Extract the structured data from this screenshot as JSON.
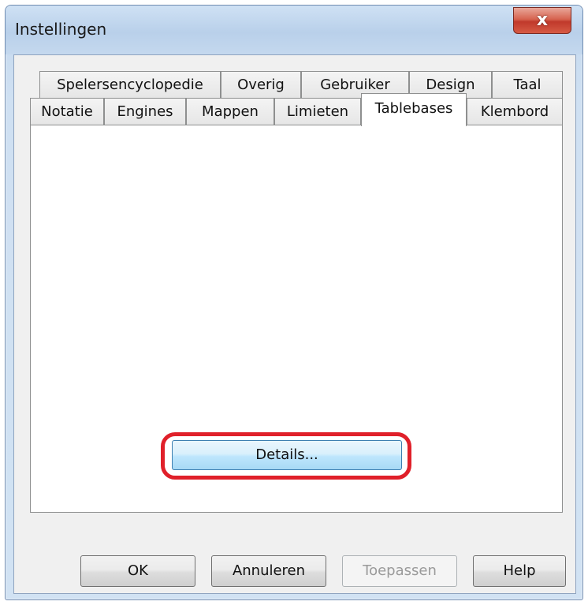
{
  "window": {
    "title": "Instellingen",
    "close_label": "x"
  },
  "tabs": {
    "row1": [
      {
        "label": "Spelersencyclopedie"
      },
      {
        "label": "Overig"
      },
      {
        "label": "Gebruiker"
      },
      {
        "label": "Design"
      },
      {
        "label": "Taal"
      }
    ],
    "row2": [
      {
        "label": "Notatie"
      },
      {
        "label": "Engines"
      },
      {
        "label": "Mappen"
      },
      {
        "label": "Limieten"
      },
      {
        "label": "Tablebases",
        "active": true
      },
      {
        "label": "Klembord"
      }
    ]
  },
  "panel": {
    "details_label": "Details..."
  },
  "buttons": {
    "ok": "OK",
    "cancel": "Annuleren",
    "apply": "Toepassen",
    "help": "Help"
  },
  "colors": {
    "highlight": "#e0202a",
    "close_button": "#c0392b"
  }
}
